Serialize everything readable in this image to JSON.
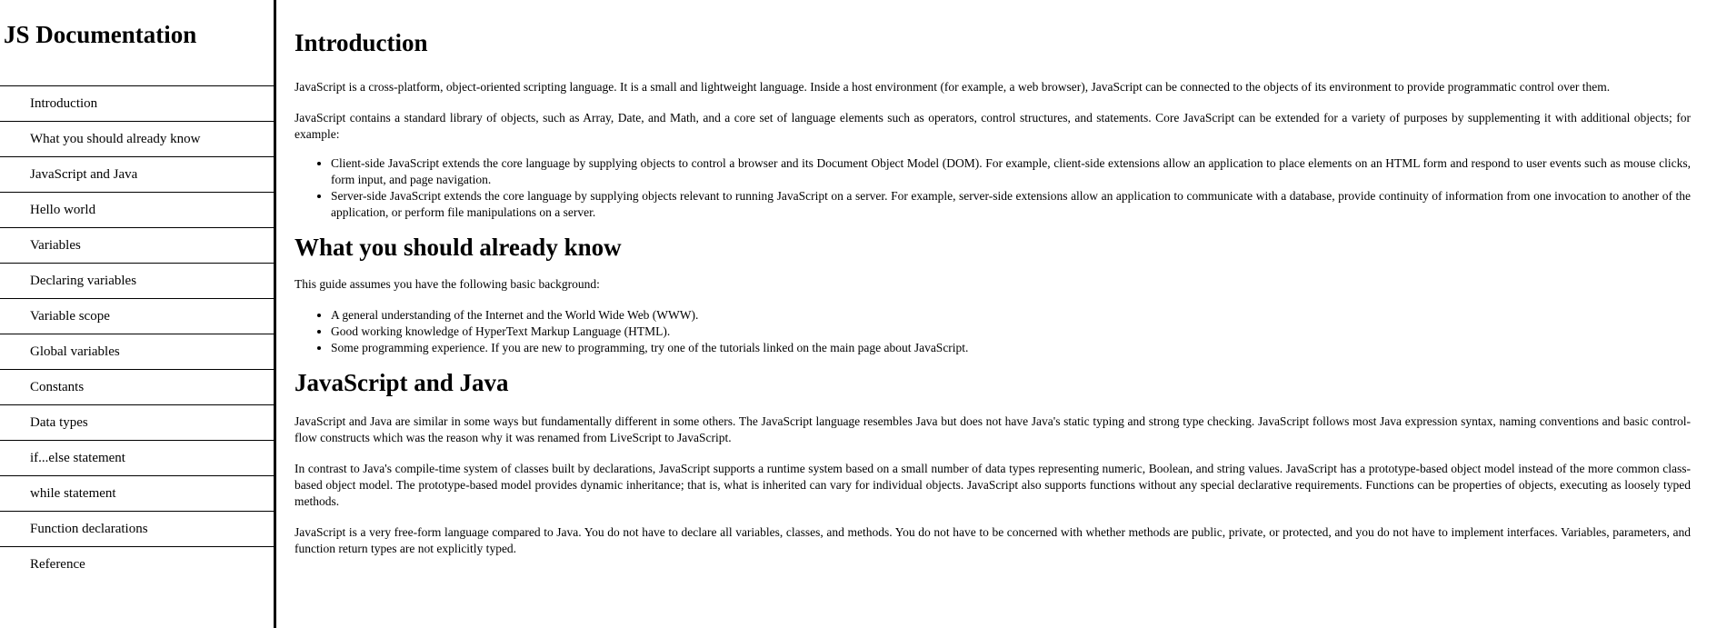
{
  "navbar": {
    "title": "JS Documentation",
    "items": [
      {
        "label": "Introduction"
      },
      {
        "label": "What you should already know"
      },
      {
        "label": "JavaScript and Java"
      },
      {
        "label": "Hello world"
      },
      {
        "label": "Variables"
      },
      {
        "label": "Declaring variables"
      },
      {
        "label": "Variable scope"
      },
      {
        "label": "Global variables"
      },
      {
        "label": "Constants"
      },
      {
        "label": "Data types"
      },
      {
        "label": "if...else statement"
      },
      {
        "label": "while statement"
      },
      {
        "label": "Function declarations"
      },
      {
        "label": "Reference"
      }
    ]
  },
  "main": {
    "introduction": {
      "heading": "Introduction",
      "p1": "JavaScript is a cross-platform, object-oriented scripting language. It is a small and lightweight language. Inside a host environment (for example, a web browser), JavaScript can be connected to the objects of its environment to provide programmatic control over them.",
      "p2": "JavaScript contains a standard library of objects, such as Array, Date, and Math, and a core set of language elements such as operators, control structures, and statements. Core JavaScript can be extended for a variety of purposes by supplementing it with additional objects; for example:",
      "bullets": [
        "Client-side JavaScript extends the core language by supplying objects to control a browser and its Document Object Model (DOM). For example, client-side extensions allow an application to place elements on an HTML form and respond to user events such as mouse clicks, form input, and page navigation.",
        "Server-side JavaScript extends the core language by supplying objects relevant to running JavaScript on a server. For example, server-side extensions allow an application to communicate with a database, provide continuity of information from one invocation to another of the application, or perform file manipulations on a server."
      ]
    },
    "already_know": {
      "heading": "What you should already know",
      "p1": "This guide assumes you have the following basic background:",
      "bullets": [
        "A general understanding of the Internet and the World Wide Web (WWW).",
        "Good working knowledge of HyperText Markup Language (HTML).",
        "Some programming experience. If you are new to programming, try one of the tutorials linked on the main page about JavaScript."
      ]
    },
    "js_and_java": {
      "heading": "JavaScript and Java",
      "p1": "JavaScript and Java are similar in some ways but fundamentally different in some others. The JavaScript language resembles Java but does not have Java's static typing and strong type checking. JavaScript follows most Java expression syntax, naming conventions and basic control-flow constructs which was the reason why it was renamed from LiveScript to JavaScript.",
      "p2": "In contrast to Java's compile-time system of classes built by declarations, JavaScript supports a runtime system based on a small number of data types representing numeric, Boolean, and string values. JavaScript has a prototype-based object model instead of the more common class-based object model. The prototype-based model provides dynamic inheritance; that is, what is inherited can vary for individual objects. JavaScript also supports functions without any special declarative requirements. Functions can be properties of objects, executing as loosely typed methods.",
      "p3": "JavaScript is a very free-form language compared to Java. You do not have to declare all variables, classes, and methods. You do not have to be concerned with whether methods are public, private, or protected, and you do not have to implement interfaces. Variables, parameters, and function return types are not explicitly typed."
    }
  }
}
